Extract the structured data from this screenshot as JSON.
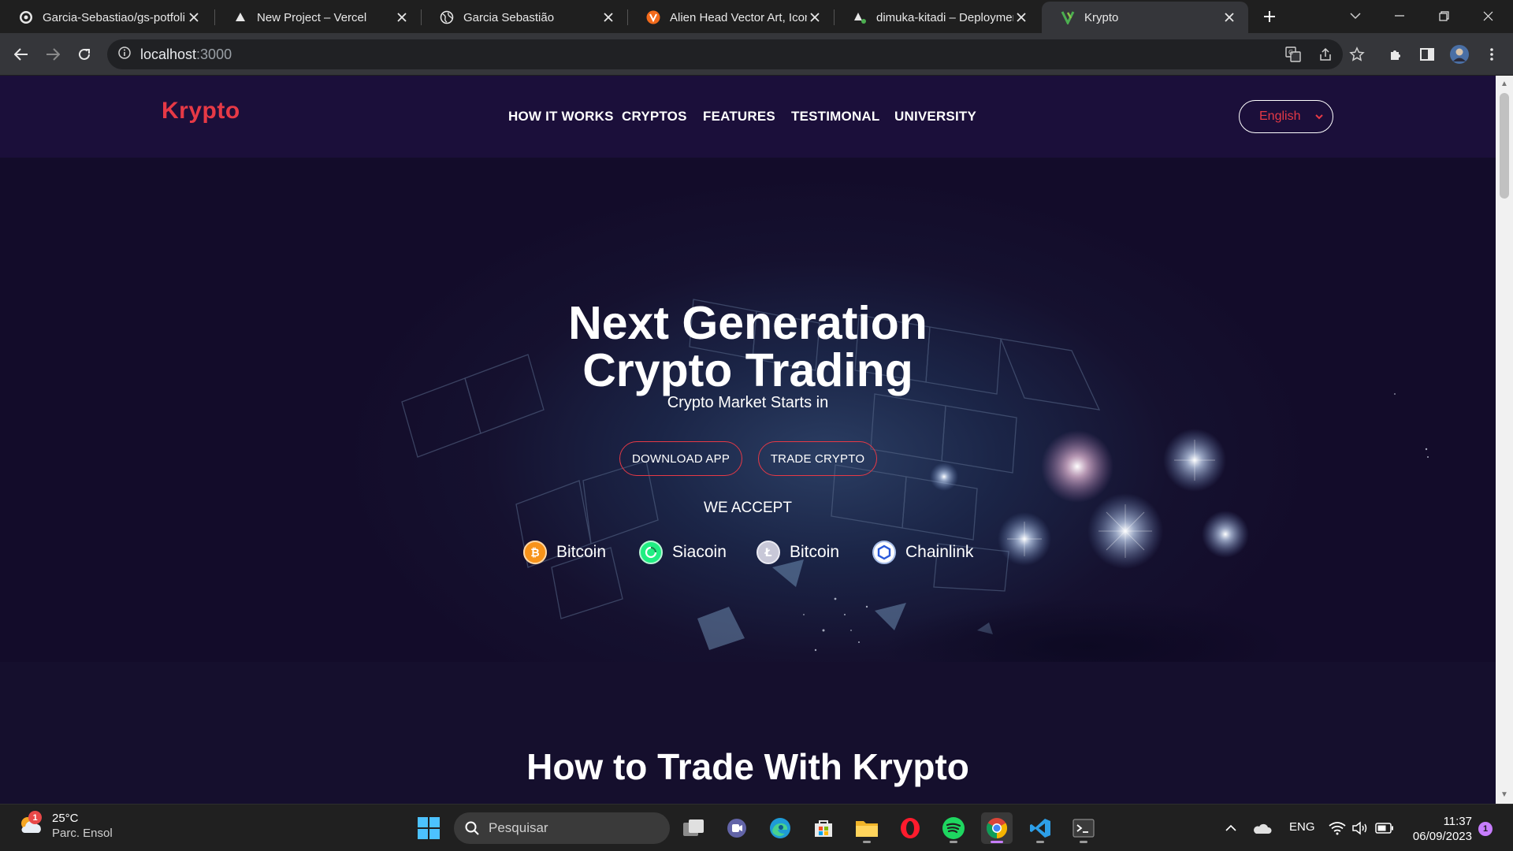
{
  "browser": {
    "tabs": [
      {
        "title": "Garcia-Sebastiao/gs-potfoli",
        "icon": "github-icon"
      },
      {
        "title": "New Project – Vercel",
        "icon": "vercel-icon"
      },
      {
        "title": "Garcia Sebastião",
        "icon": "globe-icon"
      },
      {
        "title": "Alien Head Vector Art, Icons",
        "icon": "vecteezy-icon"
      },
      {
        "title": "dimuka-kitadi – Deploymen",
        "icon": "vercel-icon"
      },
      {
        "title": "Krypto",
        "icon": "krypto-icon",
        "active": true
      }
    ],
    "address": {
      "host": "localhost",
      "port": ":3000"
    }
  },
  "site": {
    "logo": "Krypto",
    "nav": [
      "HOW IT WORKS",
      "CRYPTOS",
      "FEATURES",
      "TESTIMONAL",
      "UNIVERSITY"
    ],
    "language": "English",
    "hero": {
      "title_line1": "Next Generation",
      "title_line2": "Crypto Trading",
      "subtitle": "Crypto Market Starts in",
      "download_button": "DOWNLOAD APP",
      "trade_button": "TRADE CRYPTO",
      "accept_title": "WE ACCEPT",
      "coins": [
        {
          "name": "Bitcoin",
          "color": "#f7931a"
        },
        {
          "name": "Siacoin",
          "color": "#20ee82"
        },
        {
          "name": "Bitcoin",
          "color": "#c8c8d8"
        },
        {
          "name": "Chainlink",
          "color": "#2a5ada"
        }
      ]
    },
    "section_title": "How to Trade With Krypto",
    "colors": {
      "accent": "#e63946",
      "navbar": "#1b0f3a",
      "background": "#150f2d"
    }
  },
  "taskbar": {
    "weather": {
      "temp": "25°C",
      "desc": "Parc. Ensol",
      "badge": "1"
    },
    "search_placeholder": "Pesquisar",
    "language": "ENG",
    "time": "11:37",
    "date": "06/09/2023",
    "notifications": "1"
  }
}
